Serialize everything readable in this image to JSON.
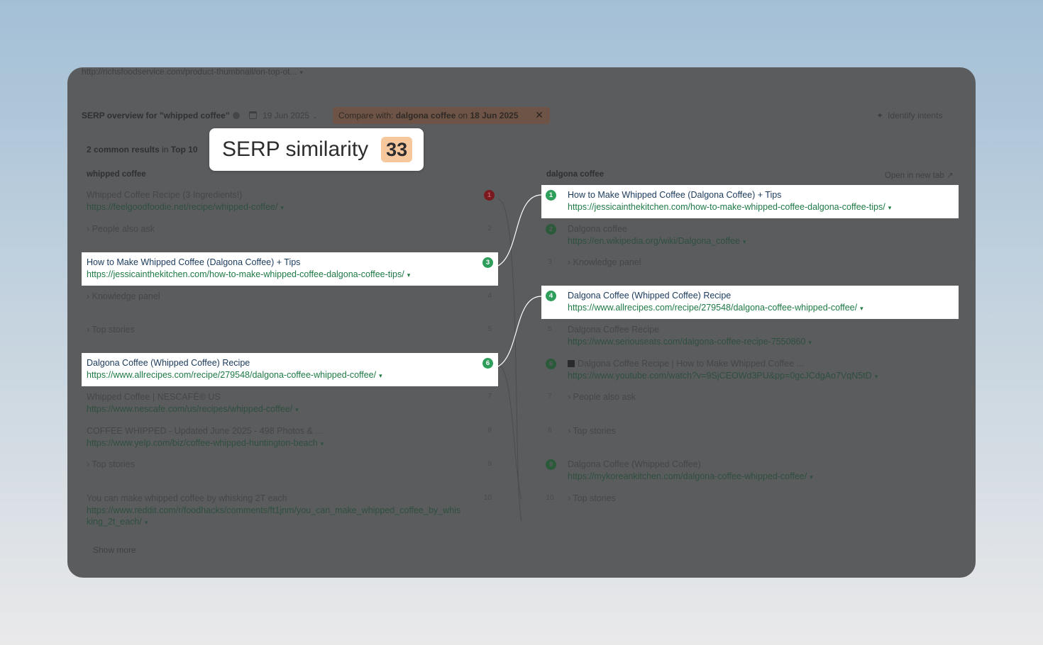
{
  "top_url": "http://richsfoodservice.com/product-thumbnail/on-top-ot...",
  "header": {
    "title": "SERP overview for \"whipped coffee\"",
    "date": "19 Jun 2025",
    "compare_prefix": "Compare with:",
    "compare_keyword": "dalgona coffee",
    "compare_on": "on",
    "compare_date": "18 Jun 2025",
    "identify_intents": "Identify intents"
  },
  "common_results": {
    "count_text": "2 common results",
    "in_text": "in",
    "top_text": "Top 10"
  },
  "similarity": {
    "label": "SERP similarity",
    "score": "33"
  },
  "left": {
    "keyword": "whipped coffee",
    "results": [
      {
        "rank": "1",
        "title": "Whipped Coffee Recipe (3 Ingredients!)",
        "url": "https://feelgoodfoodie.net/recipe/whipped-coffee/"
      },
      {
        "rank": "2",
        "label": "People also ask"
      },
      {
        "rank": "3",
        "title": "How to Make Whipped Coffee (Dalgona Coffee) + Tips",
        "url": "https://jessicainthekitchen.com/how-to-make-whipped-coffee-dalgona-coffee-tips/"
      },
      {
        "rank": "4",
        "label": "Knowledge panel"
      },
      {
        "rank": "5",
        "label": "Top stories"
      },
      {
        "rank": "6",
        "title": "Dalgona Coffee (Whipped Coffee) Recipe",
        "url": "https://www.allrecipes.com/recipe/279548/dalgona-coffee-whipped-coffee/"
      },
      {
        "rank": "7",
        "title": "Whipped Coffee | NESCAFÉ® US",
        "url": "https://www.nescafe.com/us/recipes/whipped-coffee/"
      },
      {
        "rank": "8",
        "title": "COFFEE WHIPPED - Updated June 2025 - 498 Photos & ...",
        "url": "https://www.yelp.com/biz/coffee-whipped-huntington-beach"
      },
      {
        "rank": "9",
        "label": "Top stories"
      },
      {
        "rank": "10",
        "title": "You can make whipped coffee by whisking 2T each",
        "url_line1": "https://www.reddit.com/r/foodhacks/comments/ft1jnm/you_can_make_whipped_coffee_by_whis",
        "url_line2": "king_2t_each/"
      }
    ],
    "show_more": "Show more"
  },
  "right": {
    "keyword": "dalgona coffee",
    "open_new_tab": "Open in new tab",
    "results": [
      {
        "rank": "1",
        "title": "How to Make Whipped Coffee (Dalgona Coffee) + Tips",
        "url": "https://jessicainthekitchen.com/how-to-make-whipped-coffee-dalgona-coffee-tips/"
      },
      {
        "rank": "2",
        "title": "Dalgona coffee",
        "url": "https://en.wikipedia.org/wiki/Dalgona_coffee"
      },
      {
        "rank": "3",
        "label": "Knowledge panel"
      },
      {
        "rank": "4",
        "title": "Dalgona Coffee (Whipped Coffee) Recipe",
        "url": "https://www.allrecipes.com/recipe/279548/dalgona-coffee-whipped-coffee/"
      },
      {
        "rank": "5",
        "title": "Dalgona Coffee Recipe",
        "url": "https://www.seriouseats.com/dalgona-coffee-recipe-7550860"
      },
      {
        "rank": "6",
        "title": "Dalgona Coffee Recipe | How to Make Whipped Coffee ...",
        "url": "https://www.youtube.com/watch?v=9SjCEOWd3PU&pp=0gcJCdgAo7VqN5tD"
      },
      {
        "rank": "7",
        "label": "People also ask"
      },
      {
        "rank": "8",
        "label": "Top stories"
      },
      {
        "rank": "9",
        "title": "Dalgona Coffee (Whipped Coffee)",
        "url": "https://mykoreankitchen.com/dalgona-coffee-whipped-coffee/"
      },
      {
        "rank": "10",
        "label": "Top stories"
      }
    ]
  },
  "colors": {
    "page_bg_top": "#a3bfd6",
    "overlay": "#5b5c5e",
    "highlight_bg": "#ffffff",
    "badge_green": "#2e9e5a",
    "link_green": "#1e7a45",
    "title_blue": "#1a3a5c",
    "score_bg": "#f7c89e"
  }
}
